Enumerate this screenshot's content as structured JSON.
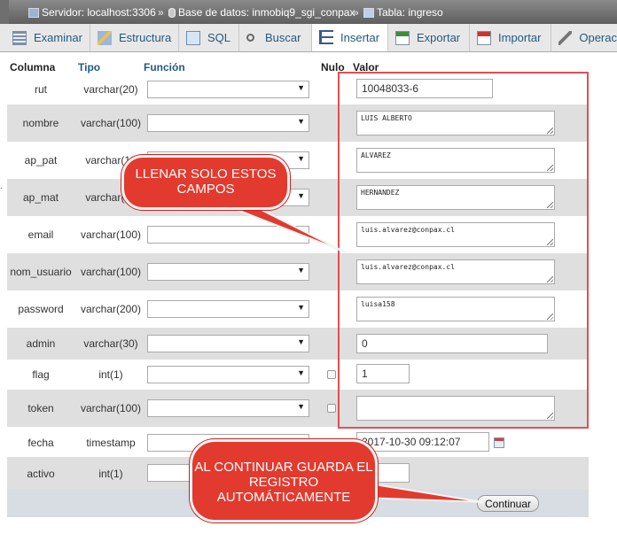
{
  "breadcrumb": {
    "server": "Servidor: localhost:3306",
    "database": "Base de datos: inmobiq9_sgi_conpax",
    "table": "Tabla: ingreso",
    "separator": "»"
  },
  "tabs": [
    {
      "label": "Examinar",
      "icon": "browse-grid-icon"
    },
    {
      "label": "Estructura",
      "icon": "structure-icon"
    },
    {
      "label": "SQL",
      "icon": "sql-icon"
    },
    {
      "label": "Buscar",
      "icon": "search-icon"
    },
    {
      "label": "Insertar",
      "icon": "insert-icon",
      "active": true
    },
    {
      "label": "Exportar",
      "icon": "export-icon"
    },
    {
      "label": "Importar",
      "icon": "import-icon"
    },
    {
      "label": "Operac",
      "icon": "wrench-icon"
    }
  ],
  "columns": {
    "column": "Columna",
    "type": "Tipo",
    "function": "Función",
    "null": "Nulo",
    "value": "Valor"
  },
  "rows": [
    {
      "name": "rut",
      "type": "varchar(20)",
      "value": "10048033-6"
    },
    {
      "name": "nombre",
      "type": "varchar(100)",
      "value": "LUIS ALBERTO"
    },
    {
      "name": "ap_pat",
      "type": "varchar(10",
      "value": "ALVAREZ"
    },
    {
      "name": "ap_mat",
      "type": "varchar(10",
      "value": "HERNANDEZ"
    },
    {
      "name": "email",
      "type": "varchar(100)",
      "value": "luis.alvarez@conpax.cl"
    },
    {
      "name": "nom_usuario",
      "type": "varchar(100)",
      "value": "luis.alvarez@conpax.cl"
    },
    {
      "name": "password",
      "type": "varchar(200)",
      "value": "luisa158"
    },
    {
      "name": "admin",
      "type": "varchar(30)",
      "value": "0"
    },
    {
      "name": "flag",
      "type": "int(1)",
      "value": "1"
    },
    {
      "name": "token",
      "type": "varchar(100)",
      "value": ""
    },
    {
      "name": "fecha",
      "type": "timestamp",
      "value": "2017-10-30 09:12:07"
    },
    {
      "name": "activo",
      "type": "int(1)",
      "value": ""
    }
  ],
  "annotations": {
    "callout1": "LLENAR SOLO ESTOS CAMPOS",
    "callout2": "AL CONTINUAR GUARDA EL REGISTRO AUTOMÁTICAMENTE"
  },
  "submit_label": "Continuar",
  "colors": {
    "accent_red": "#e23a2e",
    "link_blue": "#235a81"
  }
}
